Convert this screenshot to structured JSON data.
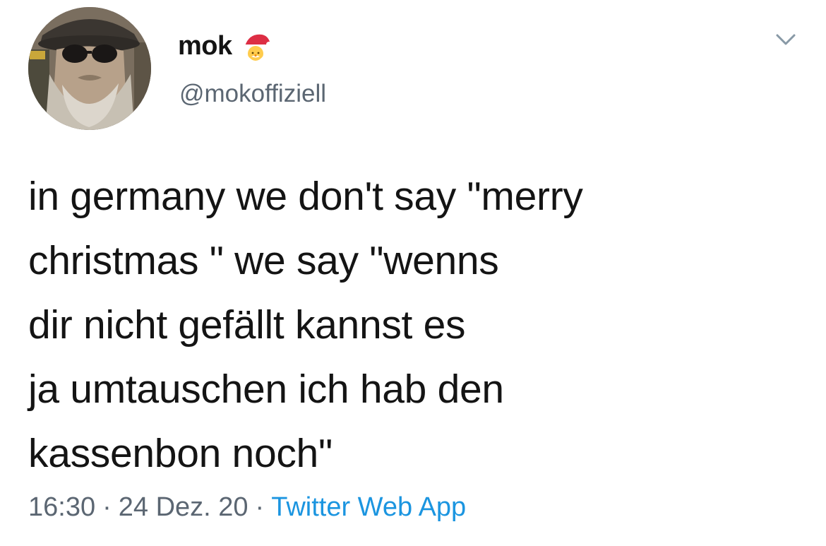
{
  "author": {
    "display_name": "mok",
    "name_emoji": "santa-emoji",
    "handle": "@mokoffiziell",
    "avatar": "avatar-photo-bearded-man-sunglasses-hat"
  },
  "menu": {
    "icon": "chevron-down-icon"
  },
  "tweet": {
    "text": "in germany we don't say \"merry\nchristmas \" we say \"wenns\ndir nicht gefällt kannst es\nja umtauschen ich hab den\nkassenbon noch\""
  },
  "meta": {
    "time": "16:30",
    "separator": "·",
    "date": "24 Dez. 20",
    "source": "Twitter Web App"
  },
  "colors": {
    "text": "#141414",
    "secondary": "#5b6672",
    "link": "#1b95e0",
    "background": "#ffffff"
  }
}
